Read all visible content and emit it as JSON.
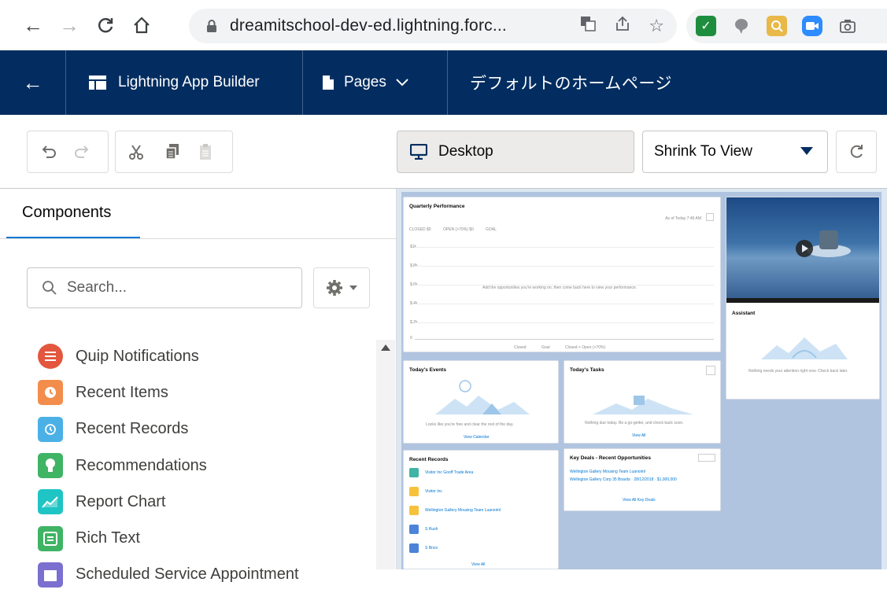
{
  "browser": {
    "url": "dreamitschool-dev-ed.lightning.forc..."
  },
  "header": {
    "app_name": "Lightning App Builder",
    "pages_label": "Pages",
    "page_title": "デフォルトのホームページ"
  },
  "toolbar": {
    "device_label": "Desktop",
    "view_mode": "Shrink To View"
  },
  "left_panel": {
    "tab_label": "Components",
    "search_placeholder": "Search...",
    "components": [
      {
        "label": "Quip Notifications",
        "icon": "quip-icon",
        "color": "#e3573e"
      },
      {
        "label": "Recent Items",
        "icon": "clock-icon",
        "color": "#f38d4c"
      },
      {
        "label": "Recent Records",
        "icon": "history-icon",
        "color": "#4bb0e6"
      },
      {
        "label": "Recommendations",
        "icon": "lightbulb-icon",
        "color": "#3fb464"
      },
      {
        "label": "Report Chart",
        "icon": "chart-icon",
        "color": "#1fc4c4"
      },
      {
        "label": "Rich Text",
        "icon": "text-icon",
        "color": "#3fb464"
      },
      {
        "label": "Scheduled Service Appointment",
        "icon": "calendar-icon",
        "color": "#7b6fcf"
      }
    ]
  },
  "canvas": {
    "quarterly": {
      "title": "Quarterly Performance",
      "as_of": "As of Today 7:46 AM",
      "metric1": "CLOSED $0",
      "metric2": "OPEN (>70%) $0",
      "metric3": "GOAL",
      "y_labels": [
        "$1k",
        "$.8k",
        "$.6k",
        "$.4k",
        "$.2k",
        "0"
      ],
      "empty_message": "Add the opportunities you're working on, then come back here to view your performance.",
      "legend": [
        "Closed",
        "Goal",
        "Closed + Open (>70%)"
      ]
    },
    "events": {
      "title": "Today's Events",
      "message": "Looks like you're free and clear the rest of the day.",
      "link": "View Calendar"
    },
    "tasks": {
      "title": "Today's Tasks",
      "message": "Nothing due today. Be a go-getter, and check back soon.",
      "link": "View All"
    },
    "recent_records": {
      "title": "Recent Records",
      "items": [
        {
          "label": "Visitor Inc Gooff Trade Area",
          "color": "#3fb4a4"
        },
        {
          "label": "Visitor Inc",
          "color": "#f6c23c"
        },
        {
          "label": "Wellington Gallery Mousing Team Luanoiml",
          "color": "#f6c23c"
        },
        {
          "label": "S Rush",
          "color": "#4b84d8"
        },
        {
          "label": "S Brice",
          "color": "#4b84d8"
        }
      ],
      "link": "View All"
    },
    "key_deals": {
      "title": "Key Deals - Recent Opportunities",
      "line1": "Wellington Gallery Mousing Team Luanoiml",
      "line2": "Wellington Gallery Corp 35 Boards · 28/12/2018 · $1,000,000",
      "link": "View All Key Deals"
    },
    "assistant": {
      "title": "Assistant",
      "message": "Nothing needs your attention right now. Check back later."
    }
  }
}
